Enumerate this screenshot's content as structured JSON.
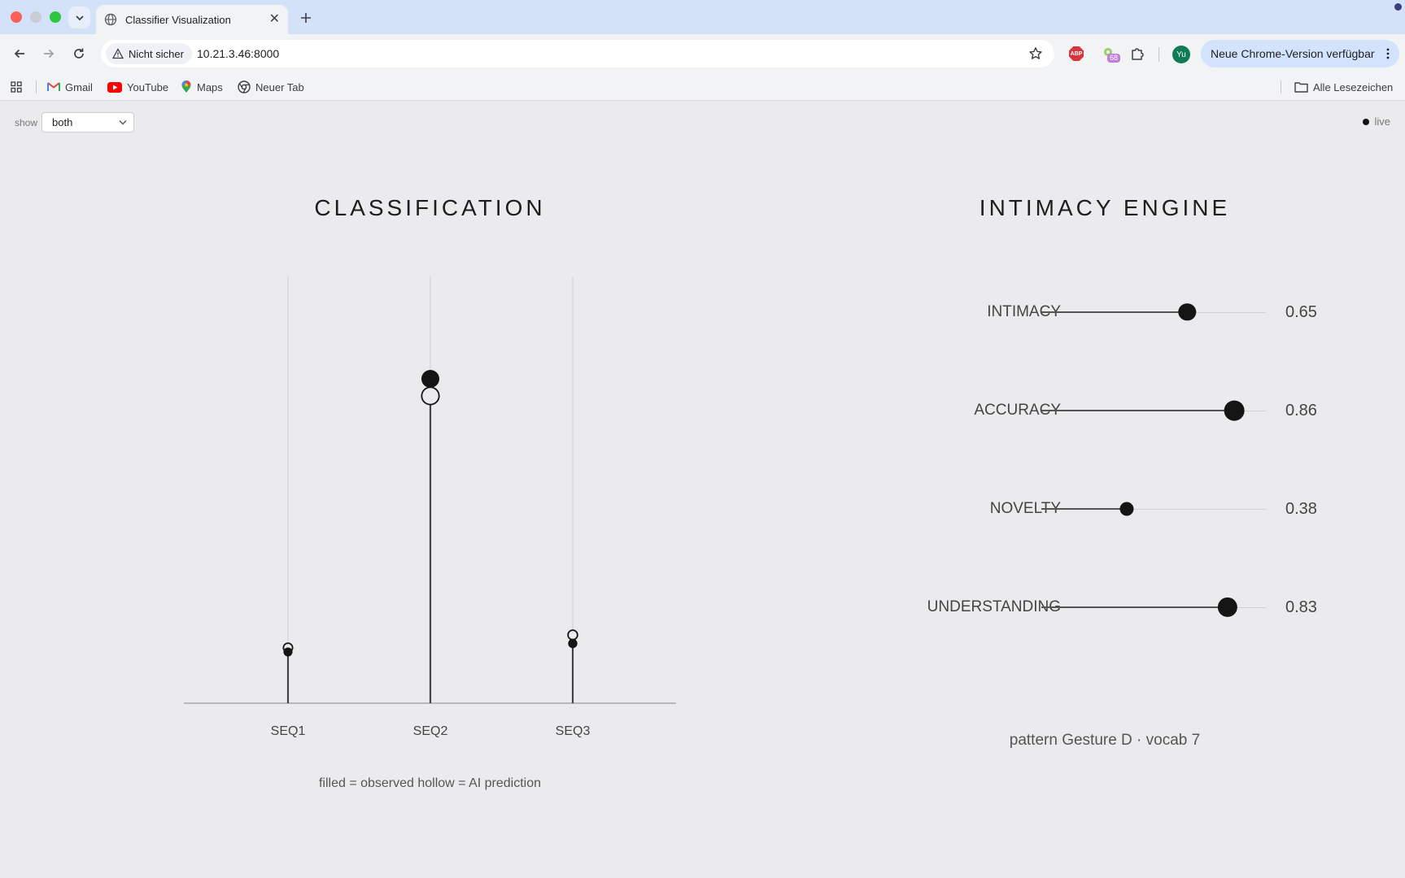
{
  "browser": {
    "tab_title": "Classifier Visualization",
    "security_label": "Nicht sicher",
    "url": "10.21.3.46:8000",
    "extension_badge": "68",
    "profile_initials": "Yu",
    "update_label": "Neue Chrome-Version verfügbar",
    "bookmarks": [
      "Gmail",
      "YouTube",
      "Maps",
      "Neuer Tab"
    ],
    "all_bookmarks": "Alle Lesezeichen"
  },
  "controls": {
    "show_label": "show",
    "show_value": "both",
    "live_label": "live"
  },
  "classification": {
    "title": "CLASSIFICATION",
    "caption": "filled = observed hollow = AI prediction"
  },
  "chart_data": {
    "type": "scatter",
    "categories": [
      "SEQ1",
      "SEQ2",
      "SEQ3"
    ],
    "series": [
      {
        "name": "observed",
        "values": [
          0.12,
          0.76,
          0.14
        ]
      },
      {
        "name": "AI prediction",
        "values": [
          0.13,
          0.72,
          0.16
        ]
      }
    ],
    "ylim": [
      0,
      1
    ]
  },
  "engine": {
    "title": "INTIMACY ENGINE",
    "sliders": [
      {
        "label": "INTIMACY",
        "value": 0.65,
        "display": "0.65"
      },
      {
        "label": "ACCURACY",
        "value": 0.86,
        "display": "0.86"
      },
      {
        "label": "NOVELTY",
        "value": 0.38,
        "display": "0.38"
      },
      {
        "label": "UNDERSTANDING",
        "value": 0.83,
        "display": "0.83"
      }
    ],
    "pattern": "pattern Gesture D · vocab 7"
  }
}
